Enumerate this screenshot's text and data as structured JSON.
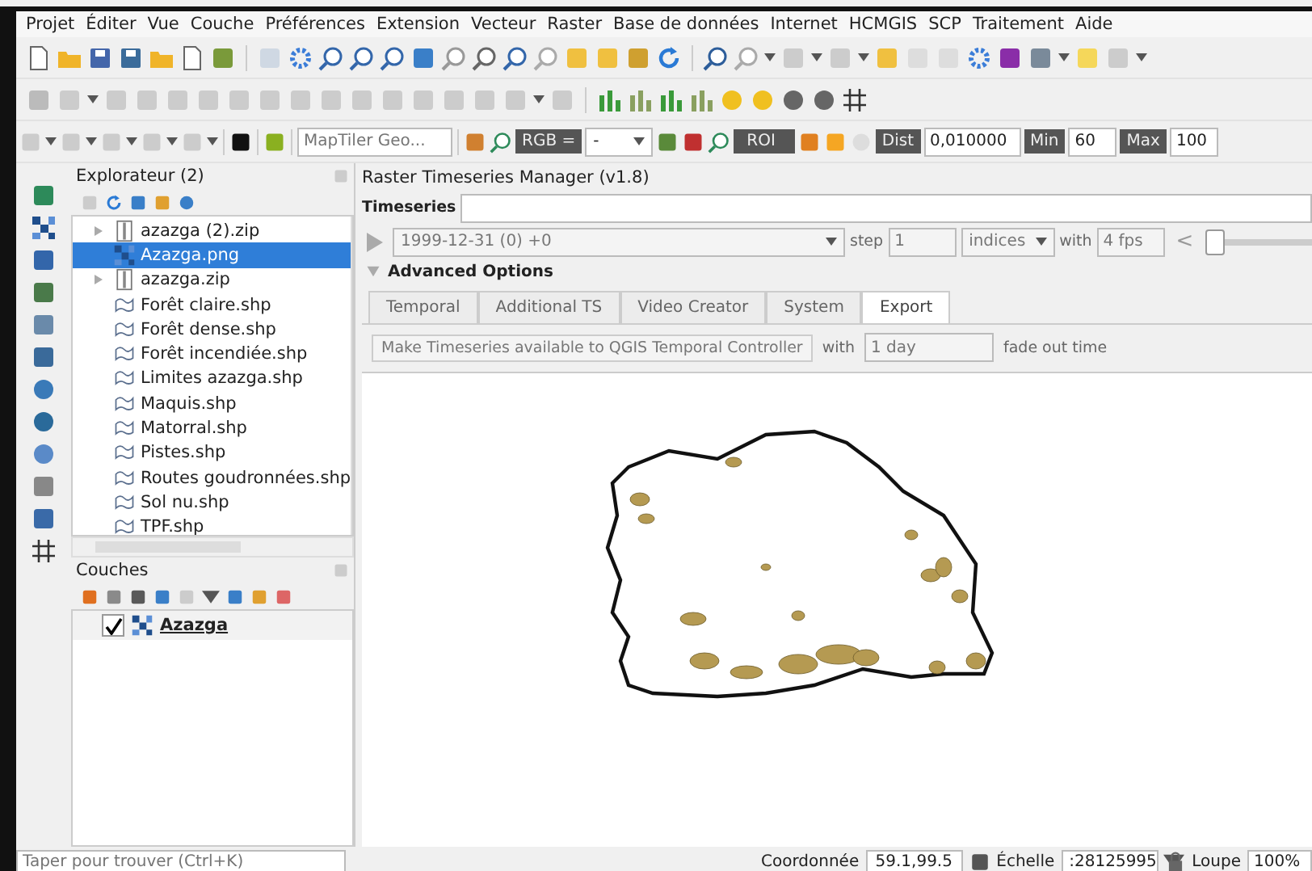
{
  "menu": [
    "Projet",
    "Éditer",
    "Vue",
    "Couche",
    "Préférences",
    "Extension",
    "Vecteur",
    "Raster",
    "Base de données",
    "Internet",
    "HCMGIS",
    "SCP",
    "Traitement",
    "Aide"
  ],
  "toolbar": {
    "geocoder": {
      "placeholder": "MapTiler Geo..."
    },
    "rgb_label": "RGB =",
    "rgb_value": "-",
    "roi_label": "ROI",
    "dist_label": "Dist",
    "dist_value": "0,010000",
    "min_label": "Min",
    "min_value": "60",
    "max_label": "Max",
    "max_value": "100"
  },
  "browser": {
    "title": "Explorateur (2)",
    "items": [
      {
        "label": "azazga (2).zip",
        "kind": "zip",
        "expanded": false,
        "selected": false
      },
      {
        "label": "Azazga.png",
        "kind": "raster",
        "selected": true
      },
      {
        "label": "azazga.zip",
        "kind": "zip",
        "expanded": false,
        "selected": false
      },
      {
        "label": "Forêt claire.shp",
        "kind": "shape",
        "selected": false
      },
      {
        "label": "Forêt dense.shp",
        "kind": "shape",
        "selected": false
      },
      {
        "label": "Forêt incendiée.shp",
        "kind": "shape",
        "selected": false
      },
      {
        "label": "Limites azazga.shp",
        "kind": "shape",
        "selected": false
      },
      {
        "label": "Maquis.shp",
        "kind": "shape",
        "selected": false
      },
      {
        "label": "Matorral.shp",
        "kind": "shape",
        "selected": false
      },
      {
        "label": "Pistes.shp",
        "kind": "shape",
        "selected": false
      },
      {
        "label": "Routes goudronnées.shp",
        "kind": "shape",
        "selected": false
      },
      {
        "label": "Sol nu.shp",
        "kind": "shape",
        "selected": false
      },
      {
        "label": "TPF.shp",
        "kind": "shape",
        "selected": false
      }
    ]
  },
  "layers": {
    "title": "Couches",
    "items": [
      {
        "label": "Azazga",
        "checked": true
      }
    ]
  },
  "plugin": {
    "title": "Raster Timeseries Manager (v1.8)",
    "timeseries_label": "Timeseries",
    "date_value": "1999-12-31 (0) +0",
    "step_label": "step",
    "step_value": "1",
    "unit_value": "indices",
    "with_label": "with",
    "fps_value": "4 fps",
    "prev_symbol": "<",
    "slider": {
      "level": 0
    },
    "advanced": {
      "label": "Advanced Options",
      "expanded": true
    },
    "tabs": [
      {
        "label": "Temporal",
        "selected": false
      },
      {
        "label": "Additional TS",
        "selected": false
      },
      {
        "label": "Video Creator",
        "selected": false
      },
      {
        "label": "System",
        "selected": false
      },
      {
        "label": "Export",
        "selected": true
      }
    ],
    "export": {
      "button": "Make Timeseries available to QGIS Temporal Controller",
      "with_label": "with",
      "duration": "1 day",
      "suffix": "fade out time"
    }
  },
  "status_bar": {
    "search_placeholder": "Taper pour trouver (Ctrl+K)",
    "coord_label": "Coordonnée",
    "coord_value": "59.1,99.5",
    "scale_label": "Échelle",
    "scale_value": ":28125995",
    "magnifier_label": "Loupe",
    "magnifier_value": "100%"
  }
}
